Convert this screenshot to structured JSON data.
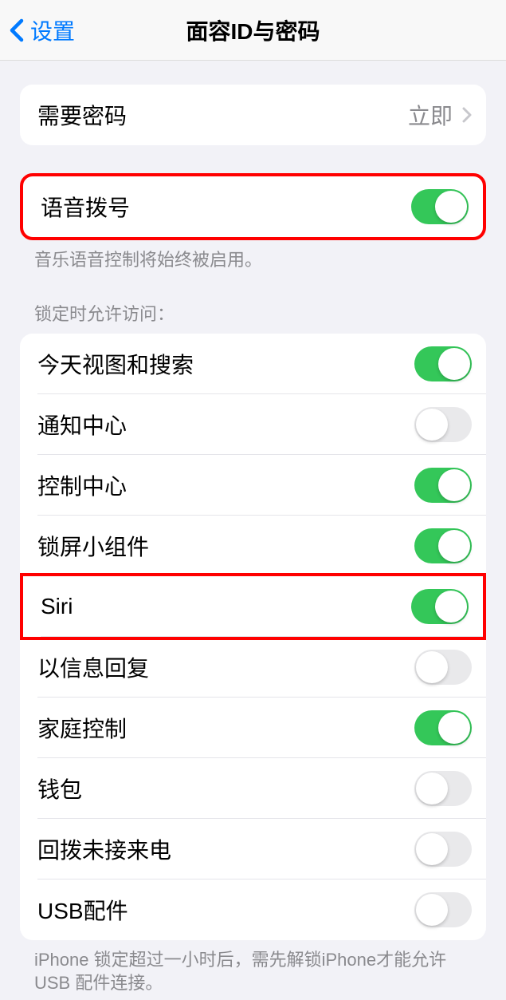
{
  "header": {
    "back_label": "设置",
    "title": "面容ID与密码"
  },
  "passcode_row": {
    "label": "需要密码",
    "value": "立即"
  },
  "voice_dial": {
    "label": "语音拨号",
    "enabled": true
  },
  "voice_dial_footer": "音乐语音控制将始终被启用。",
  "lock_section_header": "锁定时允许访问：",
  "lock_items": [
    {
      "label": "今天视图和搜索",
      "enabled": true
    },
    {
      "label": "通知中心",
      "enabled": false
    },
    {
      "label": "控制中心",
      "enabled": true
    },
    {
      "label": "锁屏小组件",
      "enabled": true
    },
    {
      "label": "Siri",
      "enabled": true
    },
    {
      "label": "以信息回复",
      "enabled": false
    },
    {
      "label": "家庭控制",
      "enabled": true
    },
    {
      "label": "钱包",
      "enabled": false
    },
    {
      "label": "回拨未接来电",
      "enabled": false
    },
    {
      "label": "USB配件",
      "enabled": false
    }
  ],
  "usb_footer": "iPhone 锁定超过一小时后，需先解锁iPhone才能允许 USB 配件连接。",
  "highlighted_items": [
    "语音拨号",
    "Siri"
  ]
}
